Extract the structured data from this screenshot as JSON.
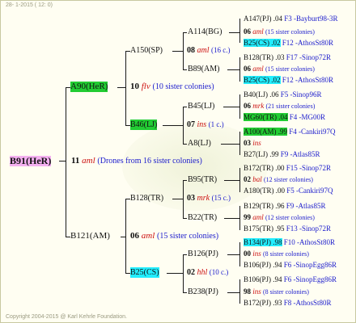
{
  "header": {
    "text": "28-  1-2015 ( 12:  0)"
  },
  "footer": {
    "text": "Copyright 2004-2015 @ Karl Kehrle Foundation."
  },
  "root": {
    "name": "B91(HeR)",
    "gen_num": "11",
    "gen_code": "aml",
    "gen_note": "(Drones from 16 sister colonies)"
  },
  "l1": {
    "top": {
      "name": "A90(HeR)",
      "num": "10",
      "code": "flv",
      "note": "(10 sister colonies)"
    },
    "bot": {
      "name": "B121(AM)",
      "num": "06",
      "code": "aml",
      "note": "(15 sister colonies)"
    }
  },
  "l2": {
    "a150": {
      "name": "A150(SP)",
      "num": "08",
      "code": "aml",
      "note": "(16 c.)"
    },
    "b46": {
      "name": "B46(LJ)",
      "num": "07",
      "code": "ins",
      "note": "(1 c.)"
    },
    "b128": {
      "name": "B128(TR)",
      "num": "03",
      "code": "mrk",
      "note": "(15 c.)"
    },
    "b25": {
      "name": "B25(CS)",
      "num": "02",
      "code": "hhl",
      "note": "(10 c.)"
    }
  },
  "l3": {
    "a114": {
      "name": "A114(BG)",
      "num": "06",
      "code": "aml",
      "note": "(15 sister colonies)"
    },
    "b89": {
      "name": "B89(AM)",
      "num": "06",
      "code": "aml",
      "note": "(15 sister colonies)"
    },
    "b45": {
      "name": "B45(LJ)",
      "num": "06",
      "code": "mrk",
      "note": "(21 sister colonies)"
    },
    "a8": {
      "name": "A8(LJ)",
      "num": "03",
      "code": "ins",
      "note": ""
    },
    "b95": {
      "name": "B95(TR)",
      "num": "02",
      "code": "bal",
      "note": "(12 sister colonies)"
    },
    "b22": {
      "name": "B22(TR)",
      "num": "99",
      "code": "aml",
      "note": "(12 sister colonies)"
    },
    "b126": {
      "name": "B126(PJ)",
      "num": "00",
      "code": "ins",
      "note": "(8 sister colonies)"
    },
    "b238": {
      "name": "B238(PJ)",
      "num": "98",
      "code": "ins",
      "note": "(8 sister colonies)"
    }
  },
  "leaf": {
    "a147": {
      "name": "A147(PJ) .04",
      "link": "F3 -Bayburt98-3R"
    },
    "b25cs_a": {
      "name": "B25(CS) .02",
      "link": "F12 -AthosSt80R"
    },
    "b128tr": {
      "name": "B128(TR) .03",
      "link": "F17 -Sinop72R"
    },
    "b25cs_b": {
      "name": "B25(CS) .02",
      "link": "F12 -AthosSt80R"
    },
    "b40": {
      "name": "B40(LJ) .06",
      "link": "F5 -Sinop96R"
    },
    "mg60": {
      "name": "MG60(TR) .04",
      "link": "F4 -MG00R"
    },
    "a100": {
      "name": "A100(AM) .99",
      "link": "F4 -Cankiri97Q"
    },
    "b27": {
      "name": "B27(LJ) .99",
      "link": "F9 -Atlas85R"
    },
    "b172a": {
      "name": "B172(TR) .00",
      "link": "F15 -Sinop72R"
    },
    "a180": {
      "name": "A180(TR) .00",
      "link": "F5 -Cankiri97Q"
    },
    "b129": {
      "name": "B129(TR) .96",
      "link": "F9 -Atlas85R"
    },
    "b175": {
      "name": "B175(TR) .95",
      "link": "F13 -Sinop72R"
    },
    "b134": {
      "name": "B134(PJ) .98",
      "link": "F10 -AthosSt80R"
    },
    "b106a": {
      "name": "B106(PJ) .94",
      "link": "F6 -SinopEgg86R"
    },
    "b106b": {
      "name": "B106(PJ) .94",
      "link": "F6 -SinopEgg86R"
    },
    "b172b": {
      "name": "B172(PJ) .93",
      "link": "F8 -AthosSt80R"
    }
  },
  "colors": {
    "pink": "#f4b0f0",
    "green": "#22cc33",
    "cyan": "#22eeff",
    "blue": "#1a1acc",
    "red": "#cc1111"
  }
}
